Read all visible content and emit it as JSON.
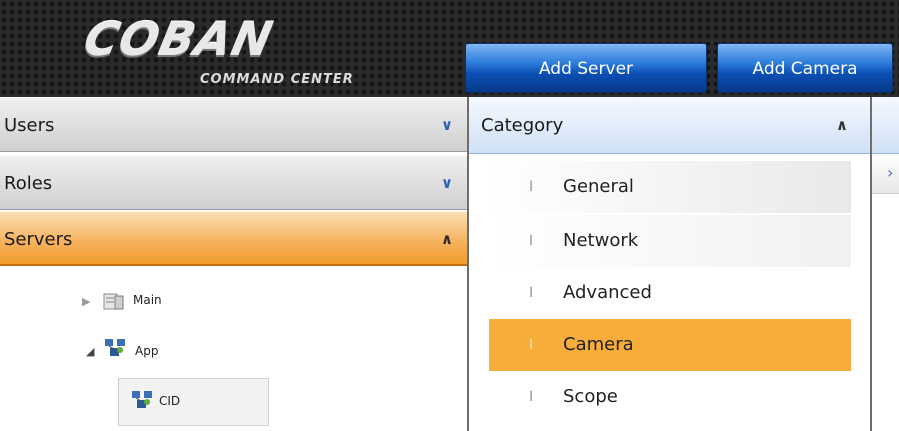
{
  "header": {
    "logo_text": "COBAN",
    "logo_subtitle": "COMMAND CENTER",
    "buttons": {
      "add_server": "Add Server",
      "add_camera": "Add Camera"
    }
  },
  "sidebar": {
    "sections": [
      {
        "label": "Users",
        "expanded": false
      },
      {
        "label": "Roles",
        "expanded": false
      },
      {
        "label": "Servers",
        "expanded": true
      }
    ],
    "tree": {
      "main": "Main",
      "app": "App",
      "cid": "CID"
    }
  },
  "category": {
    "header": "Category",
    "items": [
      {
        "label": "General",
        "selected": false
      },
      {
        "label": "Network",
        "selected": false
      },
      {
        "label": "Advanced",
        "selected": false
      },
      {
        "label": "Camera",
        "selected": true
      },
      {
        "label": "Scope",
        "selected": false
      }
    ]
  },
  "colors": {
    "accent_orange": "#f8ad3a",
    "button_blue": "#0b4fb4",
    "header_bg": "#2b2b2b"
  },
  "icons": {
    "collapse": "chevron-down-icon",
    "expand": "chevron-up-icon",
    "server": "server-icon",
    "network": "network-icon"
  }
}
